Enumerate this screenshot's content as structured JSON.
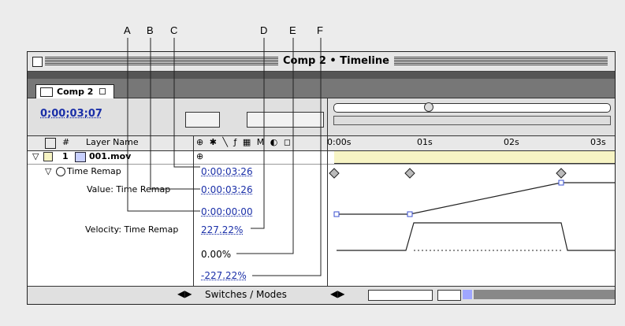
{
  "callouts": [
    "A",
    "B",
    "C",
    "D",
    "E",
    "F"
  ],
  "window": {
    "title": "Comp 2 • Timeline",
    "tab_label": "Comp 2",
    "current_time": "0;00;03;07",
    "header": {
      "hash": "#",
      "layer_name": "Layer Name",
      "switch_glyphs": "⊕ ✱ ╲ ƒ ▦ M ◐ ◻"
    },
    "time_ticks": [
      "0:00s",
      "01s",
      "02s",
      "03s"
    ],
    "layer": {
      "number": "1",
      "name": "001.mov",
      "switches": "⊕"
    },
    "rows": {
      "time_remap_label": "Time Remap",
      "time_remap_value": "0:00:03:26",
      "value_label": "Value: Time Remap",
      "value_max": "0:00:03:26",
      "value_min": "0:00:00:00",
      "velocity_label": "Velocity: Time Remap",
      "velocity_max": "227.22%",
      "velocity_zero": "0.00%",
      "velocity_min": "-227.22%"
    },
    "footer": {
      "switches_modes": "Switches / Modes"
    }
  },
  "colors": {
    "accent_blue": "#1a2fa8",
    "layer_bar": "#f7f4c4",
    "keyframe_blue": "#3a4fd0"
  }
}
